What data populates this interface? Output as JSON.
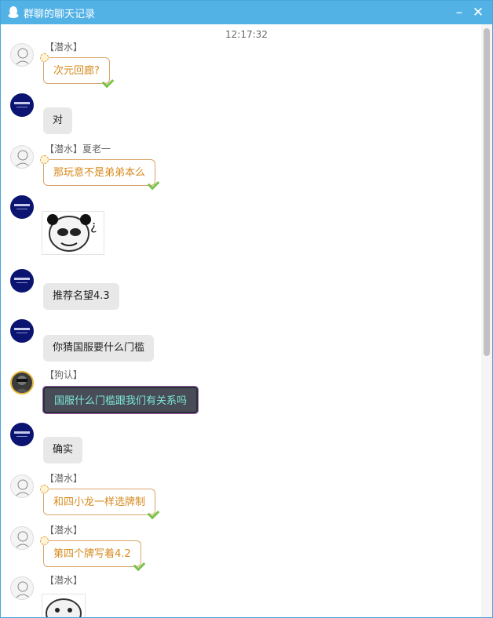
{
  "window": {
    "title": "群聊的聊天记录",
    "minimize_label": "–",
    "close_label": "✕"
  },
  "timestamp": "12:17:32",
  "icons": {
    "app": "qq-penguin-icon",
    "minimize": "minimize-icon",
    "close": "close-icon"
  },
  "colors": {
    "titlebar": "#52b2e6",
    "gold_bubble_text": "#d68a1d",
    "gray_bubble": "#e8e8e8",
    "dark_bubble_text": "#7ee8d8"
  },
  "messages": [
    {
      "name": "【潜水】",
      "text": "次元回廊?"
    },
    {
      "name": "",
      "text": "对"
    },
    {
      "name": "【潜水】夏老一",
      "text": "那玩意不是弟弟本么"
    },
    {
      "name": "",
      "text": "",
      "sticker": "panda-meme-sticker",
      "sticker_text": "¿"
    },
    {
      "name": "",
      "text": "推荐名望4.3"
    },
    {
      "name": "",
      "text": "你猜国服要什么门槛"
    },
    {
      "name": "【狗认】",
      "text": "国服什么门槛跟我们有关系吗"
    },
    {
      "name": "",
      "text": "确实"
    },
    {
      "name": "【潜水】",
      "text": "和四小龙一样选牌制"
    },
    {
      "name": "【潜水】",
      "text": "第四个牌写着4.2"
    },
    {
      "name": "【潜水】",
      "text": "",
      "sticker": "face-meme-sticker"
    }
  ]
}
